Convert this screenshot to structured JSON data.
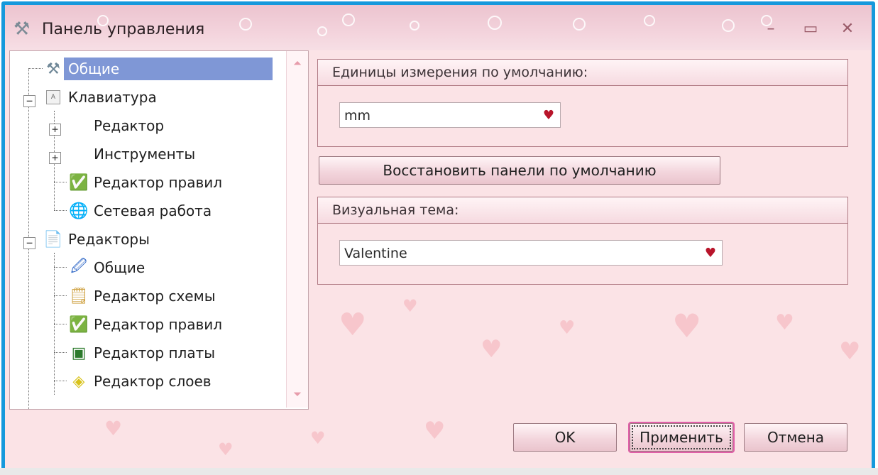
{
  "window": {
    "title": "Панель управления",
    "minimize_glyph": "–",
    "maximize_glyph": "▭",
    "close_glyph": "✕"
  },
  "tree": {
    "items": [
      {
        "label": "Общие",
        "icon": "tools-icon",
        "selected": true
      },
      {
        "label": "Клавиатура",
        "icon": "keyboard-key-icon",
        "expandable": true,
        "expanded": true
      },
      {
        "label": "Редактор",
        "icon": "none",
        "expandable": true,
        "expanded": false
      },
      {
        "label": "Инструменты",
        "icon": "none",
        "expandable": true,
        "expanded": false
      },
      {
        "label": "Редактор правил",
        "icon": "rules-editor-icon"
      },
      {
        "label": "Сетевая работа",
        "icon": "network-icon"
      },
      {
        "label": "Редакторы",
        "icon": "document-icon",
        "expandable": true,
        "expanded": true
      },
      {
        "label": "Общие",
        "icon": "edit-picture-icon"
      },
      {
        "label": "Редактор схемы",
        "icon": "schematic-icon"
      },
      {
        "label": "Редактор правил",
        "icon": "rules-editor-icon"
      },
      {
        "label": "Редактор платы",
        "icon": "board-icon"
      },
      {
        "label": "Редактор слоев",
        "icon": "layers-icon"
      }
    ]
  },
  "units_group": {
    "header": "Единицы измерения по умолчанию:",
    "value": "mm"
  },
  "restore_button": "Восстановить панели по умолчанию",
  "theme_group": {
    "header": "Визуальная тема:",
    "value": "Valentine"
  },
  "buttons": {
    "ok": "OK",
    "apply": "Применить",
    "cancel": "Отмена"
  },
  "colors": {
    "frame_border": "#1599dc",
    "selection": "#7f97d6",
    "accent_heart": "#b8142a"
  }
}
